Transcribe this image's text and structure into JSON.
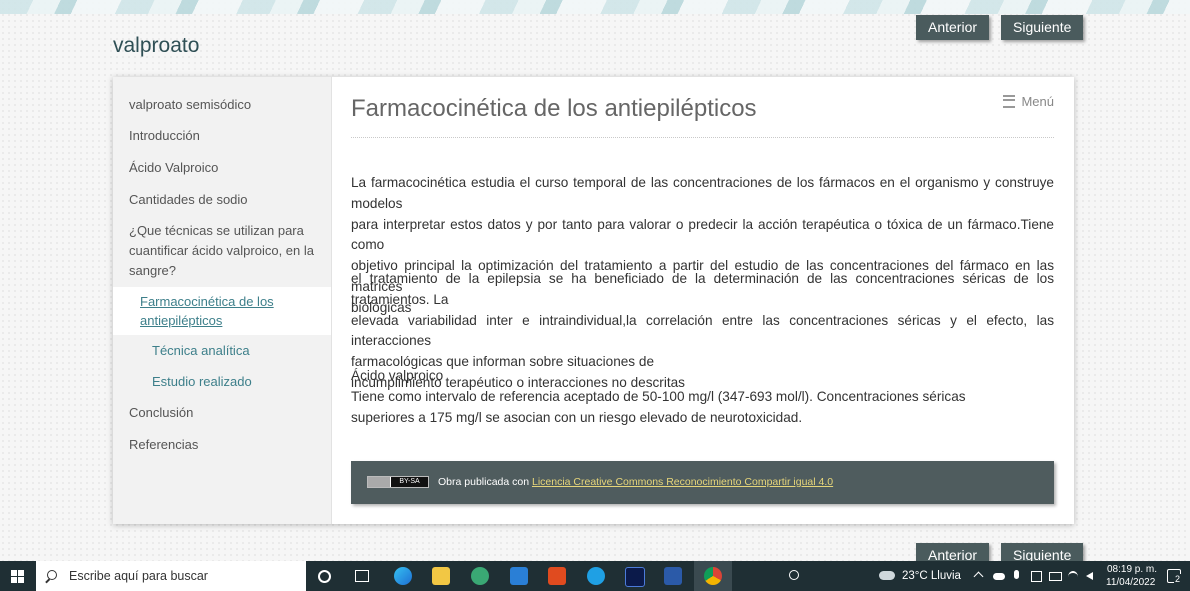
{
  "site": {
    "title": "valproato"
  },
  "nav": {
    "prev_label": "Anterior",
    "next_label": "Siguiente"
  },
  "sidebar": {
    "items": [
      {
        "label": "valproato semisódico"
      },
      {
        "label": "Introducción"
      },
      {
        "label": "Ácido Valproico"
      },
      {
        "label": "Cantidades de sodio"
      },
      {
        "label_lines": [
          "¿Que técnicas se utilizan para",
          "cuantificar ácido valproico, en la",
          "sangre?"
        ]
      },
      {
        "label_lines": [
          "Farmacocinética de los",
          "antiepilépticos"
        ]
      },
      {
        "label": "Técnica analítica"
      },
      {
        "label": "Estudio realizado"
      },
      {
        "label": "Conclusión"
      },
      {
        "label": "Referencias"
      }
    ]
  },
  "main": {
    "title": "Farmacocinética de los antiepilépticos",
    "menu_label": "Menú",
    "para1_lines": [
      "La farmacocinética estudia el curso temporal de las concentraciones de los fármacos en el organismo y construye modelos",
      "para interpretar estos datos y por tanto para valorar o predecir la acción terapéutica o tóxica de un fármaco.Tiene como",
      "objetivo principal la optimización del tratamiento a partir del estudio de las concentraciones del fármaco en las matrices",
      "biológicas"
    ],
    "para2_lines": [
      "el tratamiento de la epilepsia se ha beneficiado de la determinación de las concentraciones séricas de los tratamientos. La",
      "elevada variabilidad inter e intraindividual,la correlación entre las concentraciones séricas y el efecto, las interacciones",
      "farmacológicas que informan sobre situaciones de",
      "incumplimiento terapéutico o interacciones no descritas"
    ],
    "para3_lines": [
      "Ácido valproico",
      "Tiene como intervalo de referencia aceptado de 50-100 mg/l (347-693 mol/l). Concentraciones séricas",
      "superiores a 175 mg/l se asocian con un riesgo elevado de neurotoxicidad."
    ]
  },
  "footer": {
    "badge_text": "BY-SA",
    "text": "Obra publicada con ",
    "link_text": "Licencia Creative Commons Reconocimiento Compartir igual 4.0"
  },
  "taskbar": {
    "search_placeholder": "Escribe aquí para buscar",
    "weather": "23°C  Lluvia",
    "time": "08:19 p. m.",
    "date": "11/04/2022",
    "notification_count": "2"
  }
}
